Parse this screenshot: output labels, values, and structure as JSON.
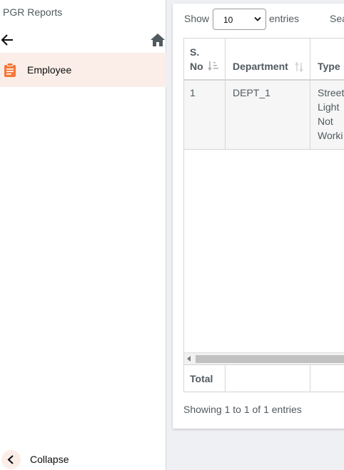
{
  "sidebar": {
    "title": "PGR Reports",
    "menu_items": [
      {
        "label": "Employee",
        "icon": "clipboard-icon",
        "active": true
      }
    ],
    "collapse_label": "Collapse"
  },
  "toolbar": {
    "show_label": "Show",
    "entries_value": "10",
    "entries_label": "entries",
    "search_label": "Sea"
  },
  "table": {
    "headers": [
      "S. No",
      "Department",
      "Type"
    ],
    "rows": [
      {
        "sno": "1",
        "department": "DEPT_1",
        "type": "Street Light Not Worki"
      }
    ],
    "footer_label": "Total"
  },
  "info_text": "Showing 1 to 1 of 1 entries",
  "colors": {
    "accent": "#f47738",
    "active_bg": "#fbeee8",
    "text": "#505a5f",
    "border": "#d6d5d4"
  }
}
